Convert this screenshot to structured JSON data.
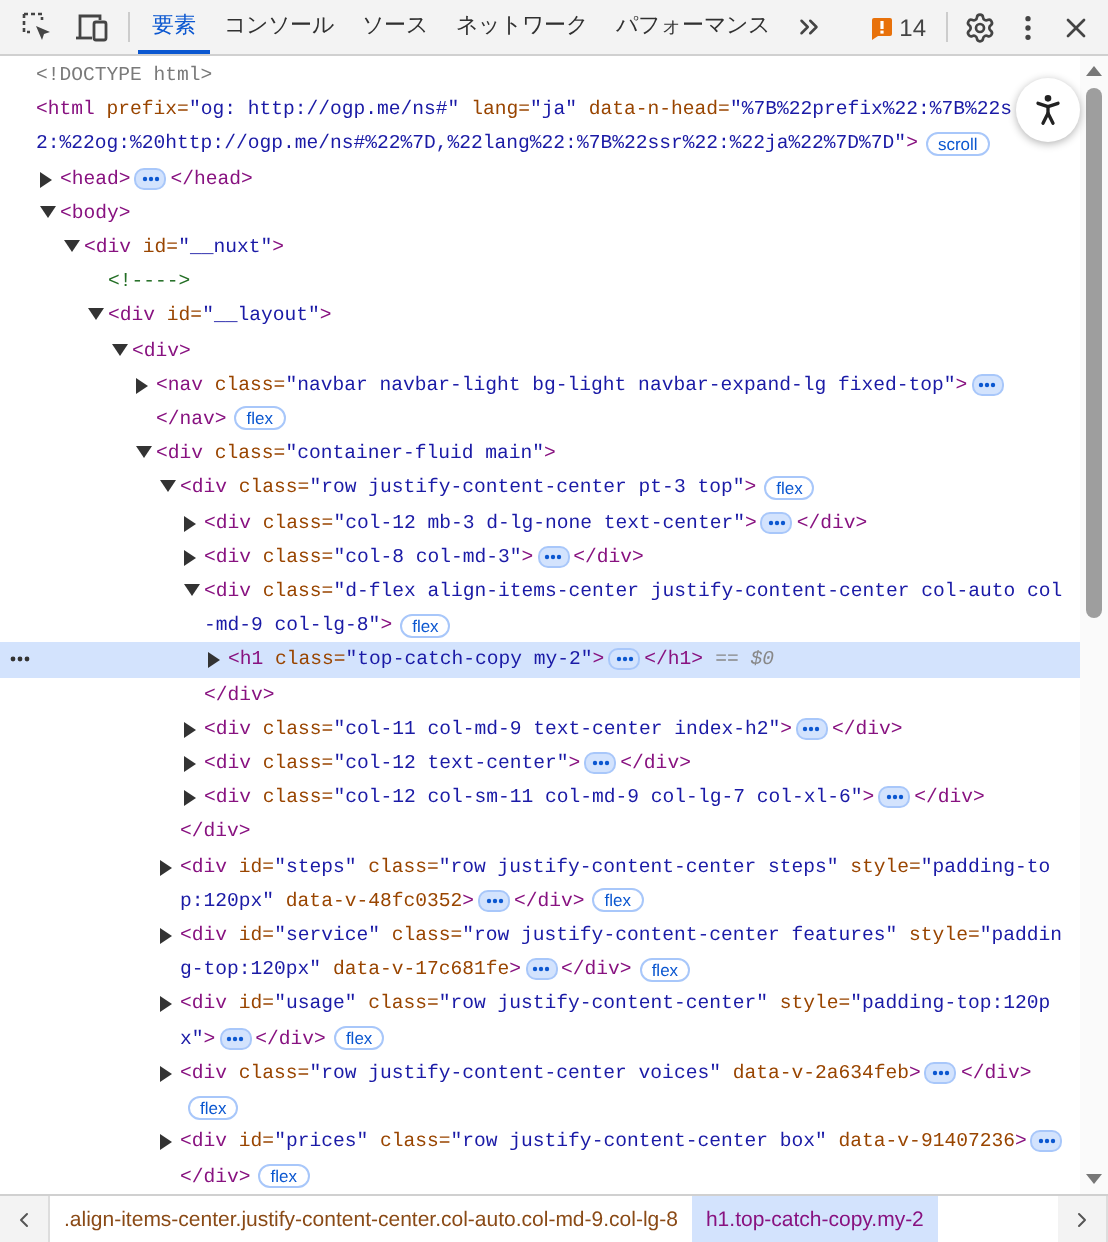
{
  "toolbar": {
    "tabs": [
      {
        "label": "要素",
        "selected": true
      },
      {
        "label": "コンソール",
        "selected": false
      },
      {
        "label": "ソース",
        "selected": false
      },
      {
        "label": "ネットワーク",
        "selected": false
      },
      {
        "label": "パフォーマンス",
        "selected": false
      }
    ],
    "issues": "14"
  },
  "dom": [
    {
      "selected": false,
      "lines": [
        [
          {
            "kind": "doctype",
            "t": "<!DOCTYPE html>"
          }
        ]
      ]
    },
    {
      "selected": false,
      "lines": [
        [
          {
            "kind": "tag",
            "t": "<html"
          },
          {
            "kind": "attr",
            "t": " prefix="
          },
          {
            "kind": "value",
            "t": "\"og: http://ogp.me/ns#\""
          },
          {
            "kind": "attr",
            "t": " lang="
          },
          {
            "kind": "value",
            "t": "\"ja\""
          },
          {
            "kind": "attr",
            "t": " data-n-head="
          },
          {
            "kind": "value",
            "t": "\"%7B%22prefix%22:%7B%22s"
          }
        ],
        [
          {
            "kind": "value",
            "t": "2:%22og:%20http://ogp.me/ns#%22%7D,%22lang%22:%7B%22ssr%22:%22ja%22%7D%7D\""
          },
          {
            "kind": "tag",
            "t": ">"
          },
          {
            "kind": "badge",
            "t": "scroll"
          }
        ]
      ],
      "children": [
        {
          "selected": false,
          "expanded": false,
          "lines": [
            [
              {
                "kind": "tag",
                "t": "<head>"
              },
              {
                "kind": "more"
              },
              {
                "kind": "tag",
                "t": "</head>"
              }
            ]
          ]
        },
        {
          "selected": false,
          "expanded": true,
          "lines": [
            [
              {
                "kind": "tag",
                "t": "<body>"
              }
            ]
          ],
          "children": [
            {
              "selected": false,
              "expanded": true,
              "lines": [
                [
                  {
                    "kind": "tag",
                    "t": "<div"
                  },
                  {
                    "kind": "attr",
                    "t": " id="
                  },
                  {
                    "kind": "value",
                    "t": "\"__nuxt\""
                  },
                  {
                    "kind": "tag",
                    "t": ">"
                  }
                ]
              ],
              "children": [
                {
                  "selected": false,
                  "lines": [
                    [
                      {
                        "kind": "comment",
                        "t": "<!---->"
                      }
                    ]
                  ]
                },
                {
                  "selected": false,
                  "expanded": true,
                  "lines": [
                    [
                      {
                        "kind": "tag",
                        "t": "<div"
                      },
                      {
                        "kind": "attr",
                        "t": " id="
                      },
                      {
                        "kind": "value",
                        "t": "\"__layout\""
                      },
                      {
                        "kind": "tag",
                        "t": ">"
                      }
                    ]
                  ],
                  "children": [
                    {
                      "selected": false,
                      "expanded": true,
                      "lines": [
                        [
                          {
                            "kind": "tag",
                            "t": "<div>"
                          }
                        ]
                      ],
                      "children": [
                        {
                          "selected": false,
                          "expanded": false,
                          "lines": [
                            [
                              {
                                "kind": "tag",
                                "t": "<nav"
                              },
                              {
                                "kind": "attr",
                                "t": " class="
                              },
                              {
                                "kind": "value",
                                "t": "\"navbar navbar-light bg-light navbar-expand-lg fixed-top\""
                              },
                              {
                                "kind": "tag",
                                "t": ">"
                              },
                              {
                                "kind": "more"
                              }
                            ],
                            [
                              {
                                "kind": "tag",
                                "t": "</nav>"
                              },
                              {
                                "kind": "badge",
                                "t": "flex"
                              }
                            ]
                          ]
                        },
                        {
                          "selected": false,
                          "expanded": true,
                          "lines": [
                            [
                              {
                                "kind": "tag",
                                "t": "<div"
                              },
                              {
                                "kind": "attr",
                                "t": " class="
                              },
                              {
                                "kind": "value",
                                "t": "\"container-fluid main\""
                              },
                              {
                                "kind": "tag",
                                "t": ">"
                              }
                            ]
                          ],
                          "children": [
                            {
                              "selected": false,
                              "expanded": true,
                              "lines": [
                                [
                                  {
                                    "kind": "tag",
                                    "t": "<div"
                                  },
                                  {
                                    "kind": "attr",
                                    "t": " class="
                                  },
                                  {
                                    "kind": "value",
                                    "t": "\"row justify-content-center pt-3 top\""
                                  },
                                  {
                                    "kind": "tag",
                                    "t": ">"
                                  },
                                  {
                                    "kind": "badge",
                                    "t": "flex"
                                  }
                                ]
                              ],
                              "close": [
                                {
                                  "kind": "tag",
                                  "t": "</div>"
                                }
                              ],
                              "children": [
                                {
                                  "selected": false,
                                  "expanded": false,
                                  "lines": [
                                    [
                                      {
                                        "kind": "tag",
                                        "t": "<div"
                                      },
                                      {
                                        "kind": "attr",
                                        "t": " class="
                                      },
                                      {
                                        "kind": "value",
                                        "t": "\"col-12 mb-3 d-lg-none text-center\""
                                      },
                                      {
                                        "kind": "tag",
                                        "t": ">"
                                      },
                                      {
                                        "kind": "more"
                                      },
                                      {
                                        "kind": "tag",
                                        "t": "</div>"
                                      }
                                    ]
                                  ]
                                },
                                {
                                  "selected": false,
                                  "expanded": false,
                                  "lines": [
                                    [
                                      {
                                        "kind": "tag",
                                        "t": "<div"
                                      },
                                      {
                                        "kind": "attr",
                                        "t": " class="
                                      },
                                      {
                                        "kind": "value",
                                        "t": "\"col-8 col-md-3\""
                                      },
                                      {
                                        "kind": "tag",
                                        "t": ">"
                                      },
                                      {
                                        "kind": "more"
                                      },
                                      {
                                        "kind": "tag",
                                        "t": "</div>"
                                      }
                                    ]
                                  ]
                                },
                                {
                                  "selected": false,
                                  "expanded": true,
                                  "lines": [
                                    [
                                      {
                                        "kind": "tag",
                                        "t": "<div"
                                      },
                                      {
                                        "kind": "attr",
                                        "t": " class="
                                      },
                                      {
                                        "kind": "value",
                                        "t": "\"d-flex align-items-center justify-content-center col-auto col"
                                      }
                                    ],
                                    [
                                      {
                                        "kind": "value",
                                        "t": "-md-9 col-lg-8\""
                                      },
                                      {
                                        "kind": "tag",
                                        "t": ">"
                                      },
                                      {
                                        "kind": "badge",
                                        "t": "flex"
                                      }
                                    ]
                                  ],
                                  "close": [
                                    {
                                      "kind": "tag",
                                      "t": "</div>"
                                    }
                                  ],
                                  "children": [
                                    {
                                      "selected": true,
                                      "expanded": false,
                                      "lines": [
                                        [
                                          {
                                            "kind": "tag",
                                            "t": "<h1"
                                          },
                                          {
                                            "kind": "attr",
                                            "t": " class="
                                          },
                                          {
                                            "kind": "value",
                                            "t": "\"top-catch-copy my-2\""
                                          },
                                          {
                                            "kind": "tag",
                                            "t": ">"
                                          },
                                          {
                                            "kind": "more"
                                          },
                                          {
                                            "kind": "tag",
                                            "t": "</h1>"
                                          },
                                          {
                                            "kind": "note",
                                            "t": "== $0"
                                          }
                                        ]
                                      ]
                                    }
                                  ]
                                },
                                {
                                  "selected": false,
                                  "expanded": false,
                                  "lines": [
                                    [
                                      {
                                        "kind": "tag",
                                        "t": "<div"
                                      },
                                      {
                                        "kind": "attr",
                                        "t": " class="
                                      },
                                      {
                                        "kind": "value",
                                        "t": "\"col-11 col-md-9 text-center index-h2\""
                                      },
                                      {
                                        "kind": "tag",
                                        "t": ">"
                                      },
                                      {
                                        "kind": "more"
                                      },
                                      {
                                        "kind": "tag",
                                        "t": "</div>"
                                      }
                                    ]
                                  ]
                                },
                                {
                                  "selected": false,
                                  "expanded": false,
                                  "lines": [
                                    [
                                      {
                                        "kind": "tag",
                                        "t": "<div"
                                      },
                                      {
                                        "kind": "attr",
                                        "t": " class="
                                      },
                                      {
                                        "kind": "value",
                                        "t": "\"col-12 text-center\""
                                      },
                                      {
                                        "kind": "tag",
                                        "t": ">"
                                      },
                                      {
                                        "kind": "more"
                                      },
                                      {
                                        "kind": "tag",
                                        "t": "</div>"
                                      }
                                    ]
                                  ]
                                },
                                {
                                  "selected": false,
                                  "expanded": false,
                                  "lines": [
                                    [
                                      {
                                        "kind": "tag",
                                        "t": "<div"
                                      },
                                      {
                                        "kind": "attr",
                                        "t": " class="
                                      },
                                      {
                                        "kind": "value",
                                        "t": "\"col-12 col-sm-11 col-md-9 col-lg-7 col-xl-6\""
                                      },
                                      {
                                        "kind": "tag",
                                        "t": ">"
                                      },
                                      {
                                        "kind": "more"
                                      },
                                      {
                                        "kind": "tag",
                                        "t": "</div>"
                                      }
                                    ]
                                  ]
                                }
                              ]
                            },
                            {
                              "selected": false,
                              "expanded": false,
                              "lines": [
                                [
                                  {
                                    "kind": "tag",
                                    "t": "<div"
                                  },
                                  {
                                    "kind": "attr",
                                    "t": " id="
                                  },
                                  {
                                    "kind": "value",
                                    "t": "\"steps\""
                                  },
                                  {
                                    "kind": "attr",
                                    "t": " class="
                                  },
                                  {
                                    "kind": "value",
                                    "t": "\"row justify-content-center steps\""
                                  },
                                  {
                                    "kind": "attr",
                                    "t": " style="
                                  },
                                  {
                                    "kind": "value",
                                    "t": "\"padding-to"
                                  }
                                ],
                                [
                                  {
                                    "kind": "value",
                                    "t": "p:120px\""
                                  },
                                  {
                                    "kind": "attr",
                                    "t": " data-v-48fc0352"
                                  },
                                  {
                                    "kind": "tag",
                                    "t": ">"
                                  },
                                  {
                                    "kind": "more"
                                  },
                                  {
                                    "kind": "tag",
                                    "t": "</div>"
                                  },
                                  {
                                    "kind": "badge",
                                    "t": "flex"
                                  }
                                ]
                              ]
                            },
                            {
                              "selected": false,
                              "expanded": false,
                              "lines": [
                                [
                                  {
                                    "kind": "tag",
                                    "t": "<div"
                                  },
                                  {
                                    "kind": "attr",
                                    "t": " id="
                                  },
                                  {
                                    "kind": "value",
                                    "t": "\"service\""
                                  },
                                  {
                                    "kind": "attr",
                                    "t": " class="
                                  },
                                  {
                                    "kind": "value",
                                    "t": "\"row justify-content-center features\""
                                  },
                                  {
                                    "kind": "attr",
                                    "t": " style="
                                  },
                                  {
                                    "kind": "value",
                                    "t": "\"paddin"
                                  }
                                ],
                                [
                                  {
                                    "kind": "value",
                                    "t": "g-top:120px\""
                                  },
                                  {
                                    "kind": "attr",
                                    "t": " data-v-17c681fe"
                                  },
                                  {
                                    "kind": "tag",
                                    "t": ">"
                                  },
                                  {
                                    "kind": "more"
                                  },
                                  {
                                    "kind": "tag",
                                    "t": "</div>"
                                  },
                                  {
                                    "kind": "badge",
                                    "t": "flex"
                                  }
                                ]
                              ]
                            },
                            {
                              "selected": false,
                              "expanded": false,
                              "lines": [
                                [
                                  {
                                    "kind": "tag",
                                    "t": "<div"
                                  },
                                  {
                                    "kind": "attr",
                                    "t": " id="
                                  },
                                  {
                                    "kind": "value",
                                    "t": "\"usage\""
                                  },
                                  {
                                    "kind": "attr",
                                    "t": " class="
                                  },
                                  {
                                    "kind": "value",
                                    "t": "\"row justify-content-center\""
                                  },
                                  {
                                    "kind": "attr",
                                    "t": " style="
                                  },
                                  {
                                    "kind": "value",
                                    "t": "\"padding-top:120p"
                                  }
                                ],
                                [
                                  {
                                    "kind": "value",
                                    "t": "x\""
                                  },
                                  {
                                    "kind": "tag",
                                    "t": ">"
                                  },
                                  {
                                    "kind": "more"
                                  },
                                  {
                                    "kind": "tag",
                                    "t": "</div>"
                                  },
                                  {
                                    "kind": "badge",
                                    "t": "flex"
                                  }
                                ]
                              ]
                            },
                            {
                              "selected": false,
                              "expanded": false,
                              "lines": [
                                [
                                  {
                                    "kind": "tag",
                                    "t": "<div"
                                  },
                                  {
                                    "kind": "attr",
                                    "t": " class="
                                  },
                                  {
                                    "kind": "value",
                                    "t": "\"row justify-content-center voices\""
                                  },
                                  {
                                    "kind": "attr",
                                    "t": " data-v-2a634feb"
                                  },
                                  {
                                    "kind": "tag",
                                    "t": ">"
                                  },
                                  {
                                    "kind": "more"
                                  },
                                  {
                                    "kind": "tag",
                                    "t": "</div>"
                                  }
                                ],
                                [
                                  {
                                    "kind": "badge",
                                    "t": "flex"
                                  }
                                ]
                              ]
                            },
                            {
                              "selected": false,
                              "expanded": false,
                              "lines": [
                                [
                                  {
                                    "kind": "tag",
                                    "t": "<div"
                                  },
                                  {
                                    "kind": "attr",
                                    "t": " id="
                                  },
                                  {
                                    "kind": "value",
                                    "t": "\"prices\""
                                  },
                                  {
                                    "kind": "attr",
                                    "t": " class="
                                  },
                                  {
                                    "kind": "value",
                                    "t": "\"row justify-content-center box\""
                                  },
                                  {
                                    "kind": "attr",
                                    "t": " data-v-91407236"
                                  },
                                  {
                                    "kind": "tag",
                                    "t": ">"
                                  },
                                  {
                                    "kind": "more"
                                  }
                                ],
                                [
                                  {
                                    "kind": "tag",
                                    "t": "</div>"
                                  },
                                  {
                                    "kind": "badge",
                                    "t": "flex"
                                  }
                                ]
                              ]
                            }
                          ]
                        }
                      ]
                    }
                  ]
                }
              ]
            }
          ]
        }
      ]
    }
  ],
  "breadcrumbs": [
    {
      "label": ".align-items-center.justify-content-center.col-auto.col-md-9.col-lg-8",
      "selected": false
    },
    {
      "label": "h1.top-catch-copy.my-2",
      "selected": true
    }
  ]
}
